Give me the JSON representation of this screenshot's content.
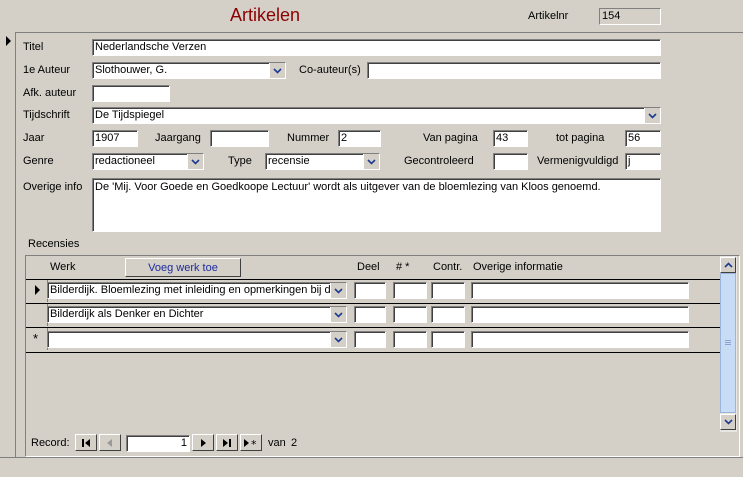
{
  "form": {
    "title": "Artikelen",
    "artikelnr_label": "Artikelnr",
    "artikelnr_value": "154"
  },
  "fields": {
    "titel_label": "Titel",
    "titel_value": "Nederlandsche Verzen",
    "auteur_label": "1e Auteur",
    "auteur_value": "Slothouwer, G.",
    "coauteur_label": "Co-auteur(s)",
    "coauteur_value": "",
    "afk_label": "Afk. auteur",
    "afk_value": "",
    "tijdschrift_label": "Tijdschrift",
    "tijdschrift_value": "De Tijdspiegel",
    "jaar_label": "Jaar",
    "jaar_value": "1907",
    "jaargang_label": "Jaargang",
    "jaargang_value": "",
    "nummer_label": "Nummer",
    "nummer_value": "2",
    "vanpagina_label": "Van pagina",
    "vanpagina_value": "43",
    "totpagina_label": "tot pagina",
    "totpagina_value": "56",
    "genre_label": "Genre",
    "genre_value": "redactioneel",
    "type_label": "Type",
    "type_value": "recensie",
    "gecontroleerd_label": "Gecontroleerd",
    "gecontroleerd_value": "",
    "vermenigvuldigd_label": "Vermenigvuldigd",
    "vermenigvuldigd_value": "j",
    "overige_label": "Overige info",
    "overige_value": "De 'Mij. Voor Goede en Goedkoope Lectuur' wordt als uitgever van de bloemlezing van Kloos genoemd."
  },
  "recensies": {
    "label": "Recensies",
    "col_werk": "Werk",
    "add_button": "Voeg werk toe",
    "col_deel": "Deel",
    "col_nr": "# *",
    "col_contr": "Contr.",
    "col_overig": "Overige informatie",
    "rows": [
      {
        "werk": "Bilderdijk. Bloemlezing met inleiding en opmerkingen bij de",
        "deel": "",
        "nr": "",
        "contr": "",
        "overig": ""
      },
      {
        "werk": "Bilderdijk als Denker en Dichter",
        "deel": "",
        "nr": "",
        "contr": "",
        "overig": ""
      },
      {
        "werk": "",
        "deel": "",
        "nr": "",
        "contr": "",
        "overig": ""
      }
    ],
    "new_row_marker": "*"
  },
  "navigation": {
    "record_label": "Record:",
    "current": "1",
    "of_label": "van",
    "total": "2"
  },
  "icons": {
    "first": "first-record-icon",
    "prev": "prev-record-icon",
    "next": "next-record-icon",
    "last": "last-record-icon",
    "new": "new-record-icon",
    "dropdown": "chevron-down-icon"
  }
}
